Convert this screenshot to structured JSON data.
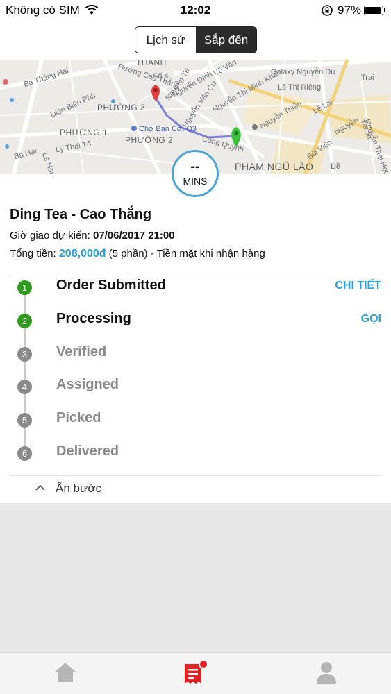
{
  "status_bar": {
    "carrier": "Không có SIM",
    "time": "12:02",
    "battery": "97%",
    "battery_level": 0.97
  },
  "tabs": {
    "history": "Lịch sử",
    "upcoming": "Sắp đến",
    "active": "upcoming"
  },
  "map": {
    "labels": {
      "thanh": "THANH",
      "ba_thang_hai": "Ba Tháng Hai",
      "duong_cao_thang": "Đường Cao Thắng",
      "so4": "Số 4",
      "nguyen_dinh": "Nguyễn Đình",
      "vo_van": "Võ Văn",
      "nguyen_thi_minh_khai": "Nguyễn Thị Minh Khai",
      "galaxy": "Galaxy Nguyễn Du",
      "le_thi_rieng": "Lê Thị Riêng",
      "phuong3": "PHƯỜNG 3",
      "dien_bien_phu": "Điện Biên Phủ",
      "nguyen_thien": "Nguyễn Thiện",
      "le_lai": "Lê Lai",
      "phuong1": "PHƯỜNG 1",
      "cho_ban_co": "Chợ Bàn Cờ, Q3",
      "phuong2": "PHƯỜNG 2",
      "cong_quynh": "Cống Quỳnh",
      "ly_thai_to": "Lý Thái Tổ",
      "ba_hat": "Ba Hạt",
      "pham_ngu_lao": "PHẠM NGŨ LÃO",
      "bui_vien": "Bùi Viện",
      "nguyen_thai_hoc": "Nguyễn Thái Học",
      "yersin": "Yersin",
      "trai": "Trai",
      "nguyen": "Nguyễn",
      "de": "Đề",
      "le_hong": "Lê Hồng",
      "nguyen_tri": "Nguyễn Tri",
      "nguyen_van_cu": "Nguyễn Văn Cừ"
    },
    "route_color": "#7b7fd9",
    "origin_pin_color": "#e04040",
    "destination_pin_color": "#3cc13c"
  },
  "timer": {
    "value": "--",
    "unit": "MINS"
  },
  "order": {
    "store_name": "Ding Tea - Cao Thắng",
    "eta_label": "Giờ giao dự kiến:",
    "eta_value": "07/06/2017 21:00",
    "total_label": "Tổng tiền:",
    "total_value": "208,000đ",
    "total_suffix": "(5 phần) - Tiền mặt khi nhận hàng"
  },
  "steps": [
    {
      "number": "1",
      "label": "Order Submitted",
      "status": "done",
      "action": "CHI TIẾT"
    },
    {
      "number": "2",
      "label": "Processing",
      "status": "done",
      "action": "GỌI"
    },
    {
      "number": "3",
      "label": "Verified",
      "status": "pending",
      "action": ""
    },
    {
      "number": "4",
      "label": "Assigned",
      "status": "pending",
      "action": ""
    },
    {
      "number": "5",
      "label": "Picked",
      "status": "pending",
      "action": ""
    },
    {
      "number": "6",
      "label": "Delivered",
      "status": "pending",
      "action": ""
    }
  ],
  "hide_steps": "Ẩn bước",
  "bottom_nav": {
    "items": [
      {
        "icon": "home-icon",
        "active": false
      },
      {
        "icon": "orders-icon",
        "active": true
      },
      {
        "icon": "profile-icon",
        "active": false
      }
    ]
  },
  "colors": {
    "accent": "#2a9fd8",
    "step_done": "#2e9a1e",
    "step_pending": "#8b8b8b",
    "orders_active": "#e02424",
    "nav_inactive": "#b5b5b5"
  }
}
